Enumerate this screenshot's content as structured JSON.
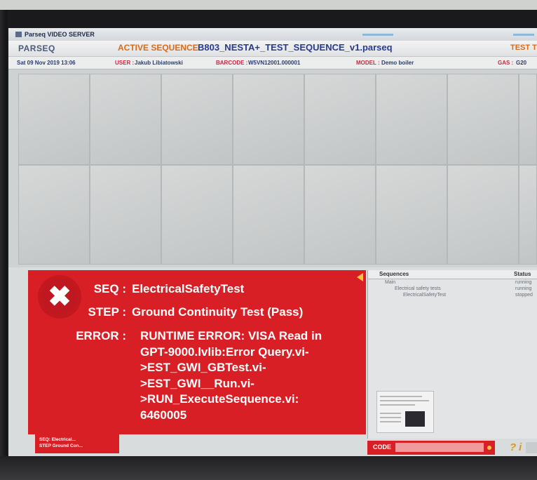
{
  "window": {
    "title": "Parseq VIDEO SERVER"
  },
  "header": {
    "logo": "PARSEQ",
    "active_sequence_label": "ACTIVE SEQUENCE :",
    "active_sequence_value": "B803_NESTA+_TEST_SEQUENCE_v1.parseq",
    "test_label": "TEST TI"
  },
  "info_bar": {
    "datetime": "Sat 09 Nov 2019 13:06",
    "user_label": "USER :",
    "user_value": "Jakub Libiatowski",
    "barcode_label": "BARCODE :",
    "barcode_value": "W5VN12001.000001",
    "model_label": "MODEL :",
    "model_value": "Demo boiler",
    "gas_label": "GAS :",
    "gas_value": "G20"
  },
  "error": {
    "seq_label": "SEQ :",
    "seq_value": "ElectricalSafetyTest",
    "step_label": "STEP :",
    "step_value": "Ground Continuity Test (Pass)",
    "error_label": "ERROR :",
    "error_message": "RUNTIME ERROR: VISA Read in\nGPT-9000.lvlib:Error Query.vi-\n>EST_GWI_GBTest.vi-\n>EST_GWI__Run.vi-\n>RUN_ExecuteSequence.vi:\n6460005"
  },
  "mini_status": {
    "seq": "SEQ: Electrical...",
    "step": "STEP Ground Con..."
  },
  "sequences_panel": {
    "col_sequences": "Sequences",
    "col_status": "Status",
    "items": [
      {
        "name": "Main",
        "status": "running"
      },
      {
        "name": "Electrical safety tests",
        "status": "running"
      },
      {
        "name": "ElectricalSafetyTest",
        "status": "stopped"
      }
    ]
  },
  "code": {
    "label": "CODE",
    "value": ""
  },
  "icons": {
    "help": "?",
    "info": "i"
  },
  "colors": {
    "error_red": "#d91f26",
    "accent_orange": "#d96a18",
    "navy": "#283a8c"
  }
}
